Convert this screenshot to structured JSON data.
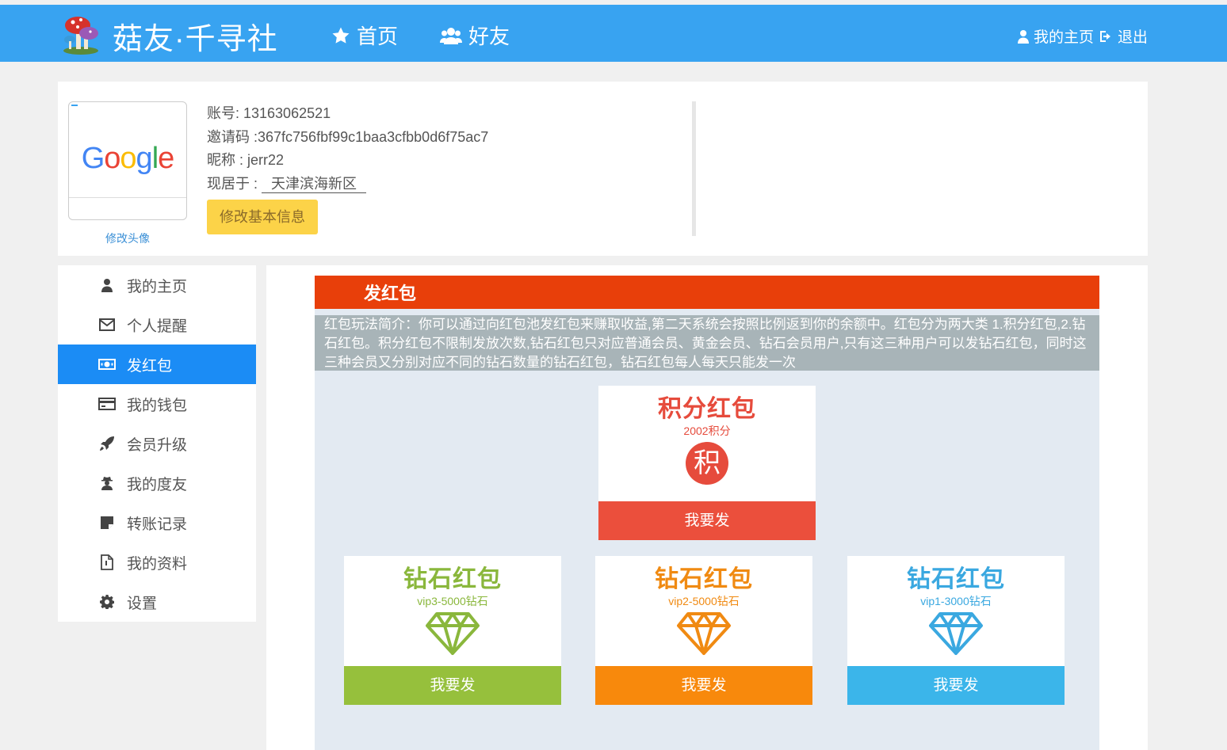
{
  "header": {
    "brand": "菇友·千寻社",
    "logo_icon": "mushroom-logo",
    "nav": [
      {
        "label": "首页",
        "icon": "star-icon"
      },
      {
        "label": "好友",
        "icon": "users-icon"
      }
    ],
    "my_home": "我的主页",
    "logout": "退出",
    "bar_color": "#38a3f1"
  },
  "profile": {
    "avatar_text": "Google",
    "change_avatar": "修改头像",
    "account": "账号: 13163062521",
    "invite": "邀请码 :367fc756fbf99c1baa3cfbb0d6f75ac7",
    "nickname": "昵称 : jerr22",
    "location_label": "现居于 :",
    "location": "天津滨海新区",
    "edit_button": "修改基本信息"
  },
  "sidebar": {
    "items": [
      {
        "label": "我的主页",
        "icon": "user-icon"
      },
      {
        "label": "个人提醒",
        "icon": "envelope-icon"
      },
      {
        "label": "发红包",
        "icon": "money-icon",
        "active": true
      },
      {
        "label": "我的钱包",
        "icon": "credit-card-icon"
      },
      {
        "label": "会员升级",
        "icon": "rocket-icon"
      },
      {
        "label": "我的度友",
        "icon": "user-secret-icon"
      },
      {
        "label": "转账记录",
        "icon": "sticky-note-icon"
      },
      {
        "label": "我的资料",
        "icon": "file-icon"
      },
      {
        "label": "设置",
        "icon": "gear-icon"
      }
    ],
    "active_color": "#1b8cf5"
  },
  "panel": {
    "title": "发红包",
    "intro": "红包玩法简介：你可以通过向红包池发红包来赚取收益,第二天系统会按照比例返到你的余额中。红包分为两大类 1.积分红包,2.钻石红包。积分红包不限制发放次数,钻石红包只对应普通会员、黄金会员、钻石会员用户,只有这三种用户可以发钻石红包，同时这三种会员又分别对应不同的钻石数量的钻石红包，钻石红包每人每天只能发一次",
    "points_card": {
      "title": "积分红包",
      "subtitle": "2002积分",
      "badge": "积",
      "button": "我要发",
      "color": "#e64b3c"
    },
    "diamond_cards": [
      {
        "title": "钻石红包",
        "subtitle": "vip3-5000钻石",
        "button": "我要发",
        "color": "#96c03c",
        "icon": "diamond-icon"
      },
      {
        "title": "钻石红包",
        "subtitle": "vip2-5000钻石",
        "button": "我要发",
        "color": "#f8890c",
        "icon": "diamond-icon"
      },
      {
        "title": "钻石红包",
        "subtitle": "vip1-3000钻石",
        "button": "我要发",
        "color": "#3bb5ea",
        "icon": "diamond-icon"
      }
    ]
  }
}
